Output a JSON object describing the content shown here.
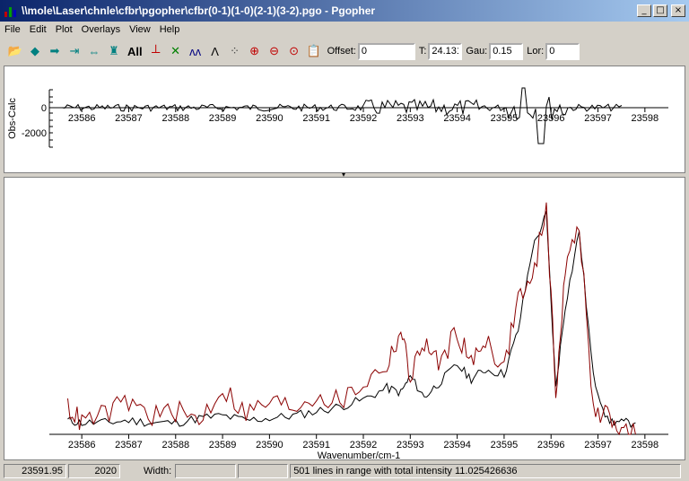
{
  "window": {
    "title": "\\\\mole\\Laser\\chnle\\cfbr\\pgopher\\cfbr(0-1)(1-0)(2-1)(3-2).pgo - Pgopher",
    "min_label": "_",
    "max_label": "□",
    "close_label": "×"
  },
  "menu": [
    "File",
    "Edit",
    "Plot",
    "Overlays",
    "View",
    "Help"
  ],
  "toolbar": {
    "icons": [
      {
        "name": "open-icon",
        "glyph": "📂",
        "color": "#c08000"
      },
      {
        "name": "arrow-left-icon",
        "glyph": "◆",
        "color": "#008080"
      },
      {
        "name": "arrow-right-icon",
        "glyph": "➡",
        "color": "#008080"
      },
      {
        "name": "shrink-icon",
        "glyph": "⇥",
        "color": "#008080"
      },
      {
        "name": "expand-icon",
        "glyph": "⇔",
        "color": "#008080"
      },
      {
        "name": "peak-find-icon",
        "glyph": "♜",
        "color": "#008080"
      }
    ],
    "all_label": "All",
    "icons2": [
      {
        "name": "stick-spectrum-icon",
        "glyph": "𝍥",
        "color": "#c00000"
      },
      {
        "name": "cross-icon",
        "glyph": "✕",
        "color": "#008000"
      },
      {
        "name": "overlay-icon",
        "glyph": "ʌʌ",
        "color": "#000080"
      },
      {
        "name": "line-profile-icon",
        "glyph": "Λ",
        "color": "#000000"
      },
      {
        "name": "scatter-icon",
        "glyph": "⁘",
        "color": "#404040"
      },
      {
        "name": "zoom-in-icon",
        "glyph": "⊕",
        "color": "#c00000"
      },
      {
        "name": "zoom-out-icon",
        "glyph": "⊖",
        "color": "#c00000"
      },
      {
        "name": "zoom-fit-icon",
        "glyph": "⊙",
        "color": "#c00000"
      },
      {
        "name": "clipboard-icon",
        "glyph": "📋",
        "color": "#404040"
      }
    ],
    "offset_label": "Offset:",
    "offset_value": "0",
    "t_label": "T:",
    "t_value": "24.131",
    "gau_label": "Gau:",
    "gau_value": "0.15",
    "lor_label": "Lor:",
    "lor_value": "0"
  },
  "residual_plot": {
    "ylabel": "Obs-Calc",
    "yticks": [
      "0",
      "-2000"
    ],
    "xticks": [
      "23586",
      "23587",
      "23588",
      "23589",
      "23590",
      "23591",
      "23592",
      "23593",
      "23594",
      "23595",
      "23596",
      "23597",
      "23598"
    ]
  },
  "spectrum_plot": {
    "xlabel": "Wavenumber/cm-1",
    "xticks": [
      "23586",
      "23587",
      "23588",
      "23589",
      "23590",
      "23591",
      "23592",
      "23593",
      "23594",
      "23595",
      "23596",
      "23597",
      "23598"
    ]
  },
  "chart_data": {
    "type": "line",
    "xlabel": "Wavenumber/cm-1",
    "xlim": [
      23585.5,
      23598.5
    ],
    "series": [
      {
        "name": "",
        "color": "#000000",
        "x": [
          23585.7,
          23586.0,
          23586.5,
          23587.0,
          23587.5,
          23588.0,
          23588.5,
          23589.0,
          23589.5,
          23590.0,
          23590.5,
          23591.0,
          23591.5,
          23592.0,
          23592.5,
          23592.8,
          23593.0,
          23593.3,
          23593.6,
          23594.0,
          23594.3,
          23594.6,
          23595.0,
          23595.3,
          23595.6,
          23595.9,
          23596.1,
          23596.3,
          23596.6,
          23596.9,
          23597.2,
          23597.5,
          23597.8
        ],
        "y": [
          0.06,
          0.05,
          0.05,
          0.06,
          0.05,
          0.05,
          0.07,
          0.08,
          0.06,
          0.07,
          0.08,
          0.1,
          0.12,
          0.15,
          0.2,
          0.18,
          0.25,
          0.16,
          0.22,
          0.3,
          0.24,
          0.28,
          0.26,
          0.45,
          0.8,
          0.95,
          0.2,
          0.55,
          0.88,
          0.25,
          0.06,
          0.05,
          0.05
        ]
      },
      {
        "name": "",
        "color": "#8b0000",
        "x": [
          23585.7,
          23586.0,
          23586.5,
          23587.0,
          23587.5,
          23588.0,
          23588.5,
          23589.0,
          23589.5,
          23590.0,
          23590.5,
          23591.0,
          23591.5,
          23592.0,
          23592.5,
          23592.8,
          23593.0,
          23593.3,
          23593.6,
          23594.0,
          23594.3,
          23594.6,
          23595.0,
          23595.3,
          23595.6,
          23595.9,
          23596.1,
          23596.3,
          23596.6,
          23596.9,
          23597.2,
          23597.5,
          23597.8
        ],
        "y": [
          0.12,
          0.05,
          0.09,
          0.14,
          0.08,
          0.1,
          0.06,
          0.2,
          0.09,
          0.14,
          0.12,
          0.17,
          0.14,
          0.22,
          0.3,
          0.45,
          0.25,
          0.4,
          0.3,
          0.45,
          0.3,
          0.42,
          0.28,
          0.6,
          0.65,
          1.0,
          0.18,
          0.7,
          0.92,
          0.1,
          0.08,
          0.02,
          0.0
        ]
      }
    ]
  },
  "status": {
    "position": "23591.95",
    "count": "2020",
    "width_label": "Width:",
    "width_value": "",
    "blank": "",
    "message": "501 lines in range with total intensity 11.025426636"
  }
}
